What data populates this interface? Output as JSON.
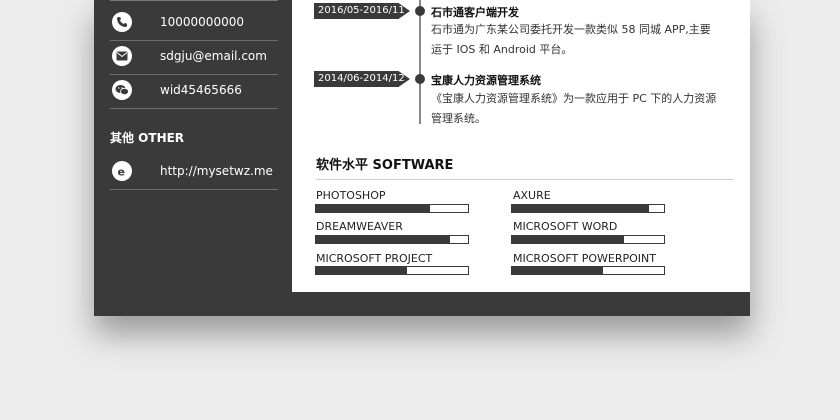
{
  "sidebar": {
    "contacts": [
      {
        "icon": "phone-icon",
        "text": "10000000000"
      },
      {
        "icon": "mail-icon",
        "text": "sdgju@email.com"
      },
      {
        "icon": "wechat-icon",
        "text": "wid45465666"
      }
    ],
    "other_heading": "其他 OTHER",
    "website": {
      "icon": "internet-explorer-icon",
      "text": "http://mysetwz.me"
    }
  },
  "experience": [
    {
      "date": "2016/05-2016/11",
      "title": "石市通客户端开发",
      "desc": "石市通为广东某公司委托开发一款类似 58 同城 APP,主要运于 IOS 和 Android 平台。"
    },
    {
      "date": "2014/06-2014/12",
      "title": "宝康人力资源管理系统",
      "desc": "《宝康人力资源管理系统》为一款应用于 PC 下的人力资源管理系统。"
    }
  ],
  "software": {
    "heading": "软件水平 SOFTWARE",
    "skills": [
      {
        "name": "PHOTOSHOP",
        "level": 0.75
      },
      {
        "name": "AXURE",
        "level": 0.9
      },
      {
        "name": "DREAMWEAVER",
        "level": 0.88
      },
      {
        "name": "MICROSOFT WORD",
        "level": 0.74
      },
      {
        "name": "MICROSOFT PROJECT",
        "level": 0.6
      },
      {
        "name": "MICROSOFT POWERPOINT",
        "level": 0.6
      }
    ]
  },
  "colors": {
    "dark": "#3a3a3a",
    "page": "#ffffff",
    "background": "#ececec"
  }
}
